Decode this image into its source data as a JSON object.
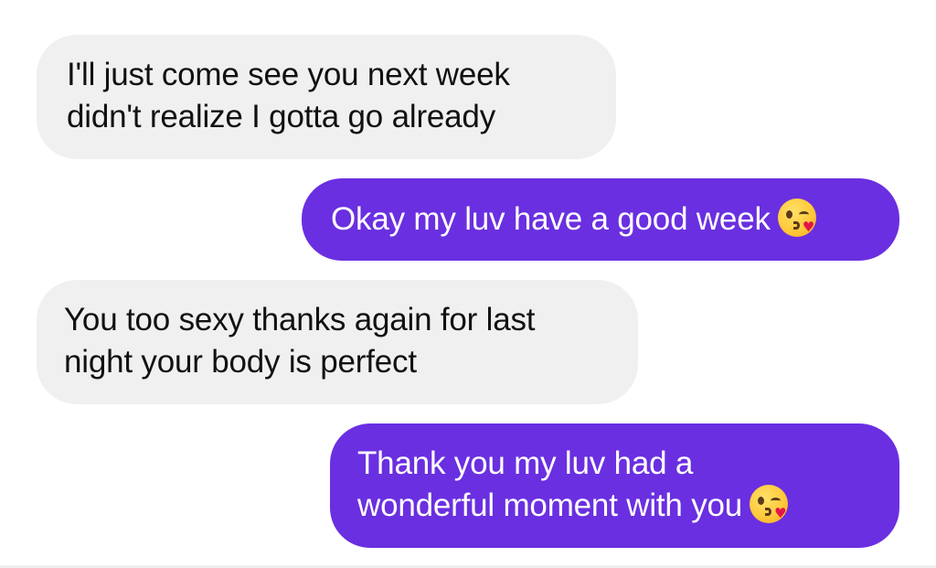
{
  "conversation": {
    "messages": [
      {
        "direction": "incoming",
        "lines": [
          "I'll just come see you next week",
          "didn't realize I gotta go already"
        ]
      },
      {
        "direction": "outgoing",
        "lines": [
          "Okay my luv have a good week"
        ],
        "emoji": "face-blowing-a-kiss-emoji"
      },
      {
        "direction": "incoming",
        "lines": [
          "You too sexy thanks again for last",
          "night your body is perfect"
        ]
      },
      {
        "direction": "outgoing",
        "lines": [
          "Thank you my luv had a",
          "wonderful moment with you"
        ],
        "emoji": "face-blowing-a-kiss-emoji"
      }
    ]
  },
  "colors": {
    "incoming_bubble": "#f0f0f0",
    "outgoing_bubble": "#6a2fe0",
    "incoming_text": "#111111",
    "outgoing_text": "#ffffff"
  }
}
